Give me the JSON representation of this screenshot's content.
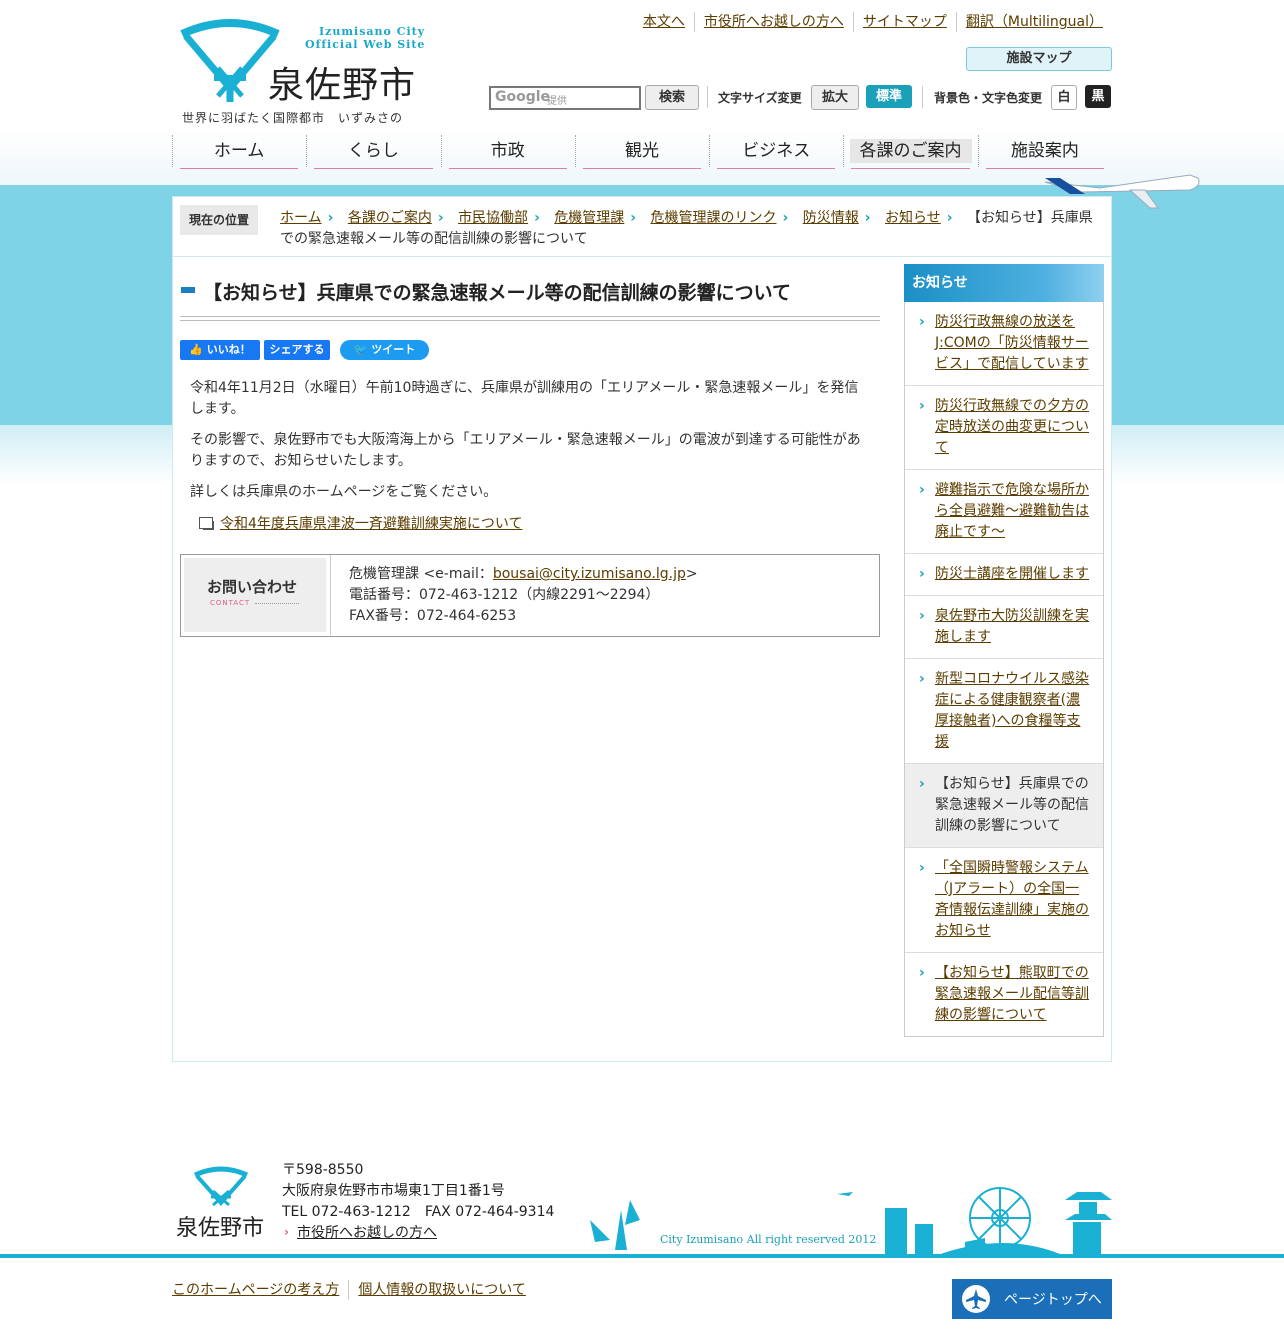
{
  "header": {
    "logo_en_line1": "Izumisano City",
    "logo_en_line2": "Official Web Site",
    "logo_name": "泉佐野市",
    "slogan": "世界に羽ばたく国際都市　いずみさの",
    "top_links": [
      "本文へ",
      "市役所へお越しの方へ",
      "サイトマップ",
      "翻訳（Multilingual）"
    ],
    "facility_map": "施設マップ",
    "search": {
      "brand": "Google",
      "provided": "提供",
      "button": "検索"
    },
    "font_size": {
      "label": "文字サイズ変更",
      "large": "拡大",
      "standard": "標準"
    },
    "color": {
      "label": "背景色・文字色変更",
      "white": "白",
      "black": "黒"
    }
  },
  "global_nav": [
    "ホーム",
    "くらし",
    "市政",
    "観光",
    "ビジネス",
    "各課のご案内",
    "施設案内"
  ],
  "breadcrumb": {
    "label": "現在の位置",
    "items": [
      "ホーム",
      "各課のご案内",
      "市民協働部",
      "危機管理課",
      "危機管理課のリンク",
      "防災情報",
      "お知らせ"
    ],
    "current": "【お知らせ】兵庫県での緊急速報メール等の配信訓練の影響について"
  },
  "article": {
    "title": "【お知らせ】兵庫県での緊急速報メール等の配信訓練の影響について",
    "social": {
      "like": "いいね！",
      "share": "シェアする",
      "tweet": "ツイート"
    },
    "p1": "令和4年11月2日（水曜日）午前10時過ぎに、兵庫県が訓練用の「エリアメール・緊急速報メール」を発信します。",
    "p2": "その影響で、泉佐野市でも大阪湾海上から「エリアメール・緊急速報メール」の電波が到達する可能性がありますので、お知らせいたします。",
    "p3": "詳しくは兵庫県のホームページをご覧ください。",
    "external_link": "令和4年度兵庫県津波一斉避難訓練実施について"
  },
  "contact": {
    "title": "お問い合わせ",
    "sub": "CONTACT",
    "dept_prefix": "危機管理課 <e-mail：",
    "email": "bousai@city.izumisano.lg.jp",
    "dept_suffix": ">",
    "phone": "電話番号：072-463-1212（内線2291～2294）",
    "fax": "FAX番号：072-464-6253"
  },
  "sidebar": {
    "title": "お知らせ",
    "items": [
      {
        "label": "防災行政無線の放送をJ:COMの「防災情報サービス」で配信しています",
        "current": false
      },
      {
        "label": "防災行政無線での夕方の定時放送の曲変更について",
        "current": false
      },
      {
        "label": "避難指示で危険な場所から全員避難～避難勧告は廃止です～",
        "current": false
      },
      {
        "label": "防災士講座を開催します",
        "current": false
      },
      {
        "label": "泉佐野市大防災訓練を実施します",
        "current": false
      },
      {
        "label": "新型コロナウイルス感染症による健康観察者(濃厚接触者)への食糧等支援",
        "current": false
      },
      {
        "label": "【お知らせ】兵庫県での緊急速報メール等の配信訓練の影響について",
        "current": true
      },
      {
        "label": "「全国瞬時警報システム（Jアラート）の全国一斉情報伝達訓練」実施のお知らせ",
        "current": false
      },
      {
        "label": "【お知らせ】熊取町での緊急速報メール配信等訓練の影響について",
        "current": false
      }
    ]
  },
  "footer": {
    "logo_name": "泉佐野市",
    "postal": "〒598-8550",
    "address": "大阪府泉佐野市市場東1丁目1番1号",
    "tel_fax": "TEL 072-463-1212　FAX 072-464-9314",
    "visit_link": "市役所へお越しの方へ",
    "copyright": "City Izumisano All right reserved 2012",
    "links": [
      "このホームページの考え方",
      "個人情報の取扱いについて"
    ],
    "page_top": "ページトップへ"
  },
  "colors": {
    "accent": "#1aa0b8",
    "link": "#5c3d00",
    "band": "#7fd3e6",
    "footer_line": "#1ab0d4",
    "pagetop": "#1a6fb8"
  }
}
